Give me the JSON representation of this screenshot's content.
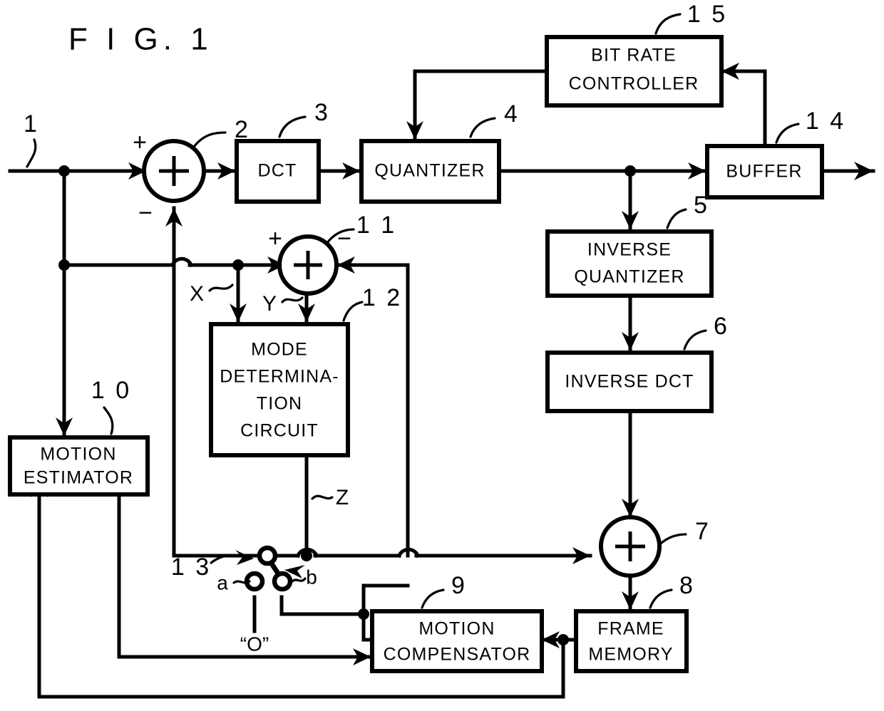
{
  "figure": {
    "title": "F I G. 1",
    "description": "Video encoder block diagram with mode determination circuit"
  },
  "blocks": [
    {
      "id": "dct",
      "label_lines": [
        "DCT"
      ],
      "ref": "3"
    },
    {
      "id": "quantizer",
      "label_lines": [
        "QUANTIZER"
      ],
      "ref": "4"
    },
    {
      "id": "bitrate",
      "label_lines": [
        "BIT RATE",
        "CONTROLLER"
      ],
      "ref": "1 5"
    },
    {
      "id": "buffer",
      "label_lines": [
        "BUFFER"
      ],
      "ref": "1 4"
    },
    {
      "id": "invquant",
      "label_lines": [
        "INVERSE",
        "QUANTIZER"
      ],
      "ref": "5"
    },
    {
      "id": "invdct",
      "label_lines": [
        "INVERSE DCT"
      ],
      "ref": "6"
    },
    {
      "id": "framemem",
      "label_lines": [
        "FRAME",
        "MEMORY"
      ],
      "ref": "8"
    },
    {
      "id": "motcomp",
      "label_lines": [
        "MOTION",
        "COMPENSATOR"
      ],
      "ref": "9"
    },
    {
      "id": "motest",
      "label_lines": [
        "MOTION",
        "ESTIMATOR"
      ],
      "ref": "1 0"
    },
    {
      "id": "modedet",
      "label_lines": [
        "MODE",
        "DETERMINA-",
        "TION",
        "CIRCUIT"
      ],
      "ref": "1 2"
    }
  ],
  "adders": [
    {
      "id": "adder2",
      "ref": "2",
      "glyph": "+",
      "input_signs": [
        "+",
        "−"
      ]
    },
    {
      "id": "adder11",
      "ref": "1 1",
      "glyph": "+",
      "input_signs": [
        "+",
        "−"
      ]
    },
    {
      "id": "adder7",
      "ref": "7",
      "glyph": "+",
      "input_signs": []
    }
  ],
  "switch": {
    "ref": "1 3",
    "terminal_a": "a",
    "terminal_b": "b",
    "zero_label": "“O”"
  },
  "signal_labels": {
    "input": "1",
    "x": "X",
    "y": "Y",
    "z": "Z"
  },
  "colors": {
    "ink": "#000000",
    "paper": "#ffffff"
  }
}
